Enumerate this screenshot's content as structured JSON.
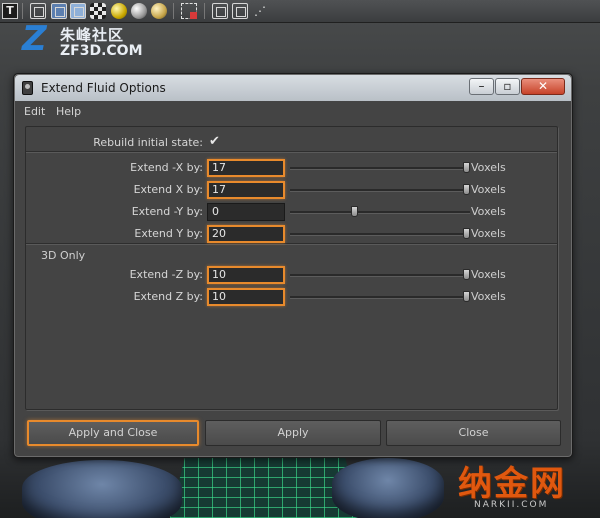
{
  "toolbar": {
    "icons": [
      "text-tool-icon",
      "cube-wire-icon",
      "cube-smooth-icon",
      "cube-textured-icon",
      "checker-icon",
      "sphere-yellow-icon",
      "sphere-grey-icon",
      "sphere-gold-icon",
      "select-region-icon",
      "cube-icon",
      "cube-frame-icon",
      "nodes-icon"
    ],
    "t_label": "T",
    "nodes_glyph": "⋰"
  },
  "logo": {
    "mark": "Z",
    "chinese": "朱峰社区",
    "english": "ZF3D.COM"
  },
  "watermark": {
    "chinese": "纳金网",
    "english": "NARKII.COM"
  },
  "dialog": {
    "title": "Extend Fluid Options",
    "window_buttons": {
      "minimize": "–",
      "maximize": "▫",
      "close": "✕"
    },
    "menu": {
      "edit": "Edit",
      "help": "Help"
    },
    "rebuild": {
      "label": "Rebuild initial state:",
      "checked": true,
      "check_glyph": "✔"
    },
    "section_3d": "3D Only",
    "unit": "Voxels",
    "rows": [
      {
        "label": "Extend -X by:",
        "value": "17",
        "slider_fraction": 1.0,
        "highlighted": true
      },
      {
        "label": "Extend  X by:",
        "value": "17",
        "slider_fraction": 1.0,
        "highlighted": true
      },
      {
        "label": "Extend -Y by:",
        "value": "0",
        "slider_fraction": 0.35,
        "highlighted": false
      },
      {
        "label": "Extend  Y by:",
        "value": "20",
        "slider_fraction": 1.0,
        "highlighted": true
      },
      {
        "label": "Extend -Z by:",
        "value": "10",
        "slider_fraction": 1.0,
        "highlighted": true
      },
      {
        "label": "Extend  Z by:",
        "value": "10",
        "slider_fraction": 1.0,
        "highlighted": true
      }
    ],
    "buttons": {
      "apply_close": "Apply and Close",
      "apply": "Apply",
      "close": "Close"
    },
    "accent_color": "#e88a2c"
  }
}
